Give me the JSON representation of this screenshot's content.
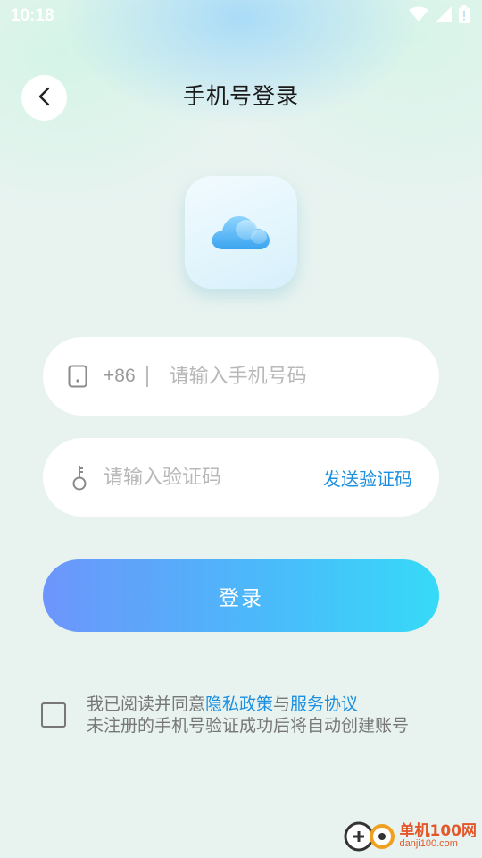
{
  "status_bar": {
    "time": "10:18"
  },
  "header": {
    "title": "手机号登录"
  },
  "phone_field": {
    "country_code": "+86",
    "placeholder": "请输入手机号码",
    "value": ""
  },
  "code_field": {
    "placeholder": "请输入验证码",
    "value": "",
    "send_code_label": "发送验证码"
  },
  "login_button": {
    "label": "登录"
  },
  "agreement": {
    "checked": false,
    "prefix": "我已阅读并同意",
    "privacy_link": "隐私政策",
    "conjunction": "与",
    "service_link": "服务协议",
    "note": "未注册的手机号验证成功后将自动创建账号"
  },
  "watermark": {
    "name": "单机100网",
    "url": "danji100.com"
  },
  "colors": {
    "accent": "#1c8fe0",
    "button_start": "#6d95fb",
    "button_end": "#36daf8",
    "background": "#e8f3f0"
  },
  "icons": {
    "back": "chevron-left-icon",
    "logo": "cloud-icon",
    "phone": "phone-icon",
    "key": "key-icon",
    "wifi": "wifi-icon",
    "signal": "signal-icon",
    "battery": "battery-icon"
  }
}
